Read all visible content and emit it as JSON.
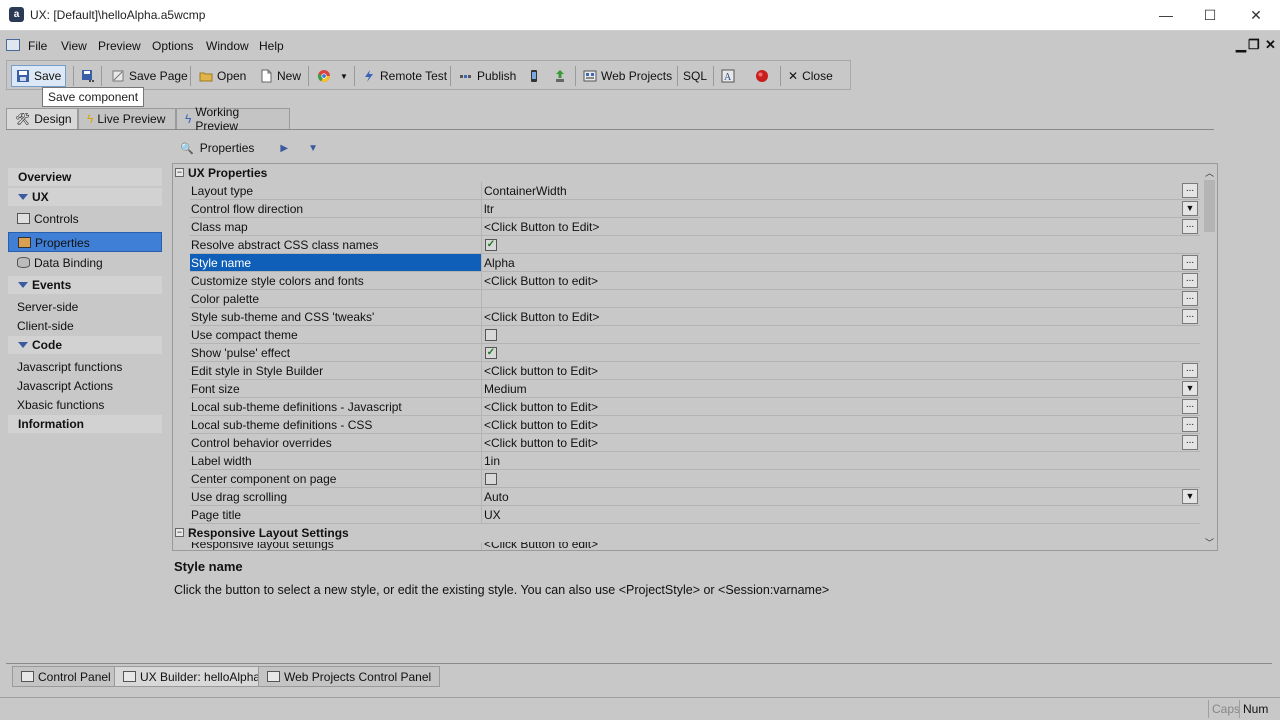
{
  "window": {
    "title": "UX: [Default]\\helloAlpha.a5wcmp",
    "minimize": "—",
    "maximize": "☐",
    "close": "✕"
  },
  "menu": {
    "items": [
      "File",
      "View",
      "Preview",
      "Options",
      "Window",
      "Help"
    ]
  },
  "toolbar": {
    "save": "Save",
    "save_page": "Save Page",
    "open": "Open",
    "new": "New",
    "remote_test": "Remote Test",
    "publish": "Publish",
    "web_projects": "Web Projects",
    "sql": "SQL",
    "close": "Close",
    "tooltip": "Save component"
  },
  "view_tabs": [
    "Design",
    "Live Preview",
    "Working Preview"
  ],
  "nav": {
    "overview": "Overview",
    "ux": "UX",
    "controls": "Controls",
    "properties": "Properties",
    "data_binding": "Data Binding",
    "events": "Events",
    "server_side": "Server-side",
    "client_side": "Client-side",
    "code": "Code",
    "js_functions": "Javascript functions",
    "js_actions": "Javascript Actions",
    "xbasic_functions": "Xbasic functions",
    "information": "Information"
  },
  "properties_header": "Properties",
  "grid": {
    "section1": "UX Properties",
    "section2": "Responsive Layout Settings",
    "rows": [
      {
        "name": "Layout type",
        "value": "ContainerWidth"
      },
      {
        "name": "Control flow direction",
        "value": "ltr"
      },
      {
        "name": "Class map",
        "value": "<Click Button to Edit>"
      },
      {
        "name": "Resolve abstract CSS class names",
        "value": ""
      },
      {
        "name": "Style name",
        "value": "Alpha"
      },
      {
        "name": "Customize style colors and fonts",
        "value": "<Click Button to edit>"
      },
      {
        "name": "Color palette",
        "value": ""
      },
      {
        "name": "Style sub-theme and CSS 'tweaks'",
        "value": "<Click Button to Edit>"
      },
      {
        "name": "Use compact theme",
        "value": ""
      },
      {
        "name": "Show 'pulse' effect",
        "value": ""
      },
      {
        "name": "Edit style in Style Builder",
        "value": "<Click button to Edit>"
      },
      {
        "name": "Font size",
        "value": "Medium"
      },
      {
        "name": "Local sub-theme definitions - Javascript",
        "value": "<Click button to Edit>"
      },
      {
        "name": "Local sub-theme definitions - CSS",
        "value": "<Click button to Edit>"
      },
      {
        "name": "Control behavior overrides",
        "value": "<Click button to Edit>"
      },
      {
        "name": "Label width",
        "value": "1in"
      },
      {
        "name": "Center component on page",
        "value": ""
      },
      {
        "name": "Use drag scrolling",
        "value": "Auto"
      },
      {
        "name": "Page title",
        "value": "UX"
      }
    ],
    "partial_row": {
      "name": "Responsive layout settings",
      "value": "<Click Button to edit>"
    }
  },
  "description": {
    "title": "Style name",
    "text": "Click the button to select a new style, or edit the existing style. You can also use <ProjectStyle> or <Session:varname>"
  },
  "bottom_tabs": [
    "Control Panel",
    "UX Builder: helloAlpha",
    "Web Projects Control Panel"
  ],
  "status": {
    "caps": "Caps",
    "num": "Num"
  }
}
